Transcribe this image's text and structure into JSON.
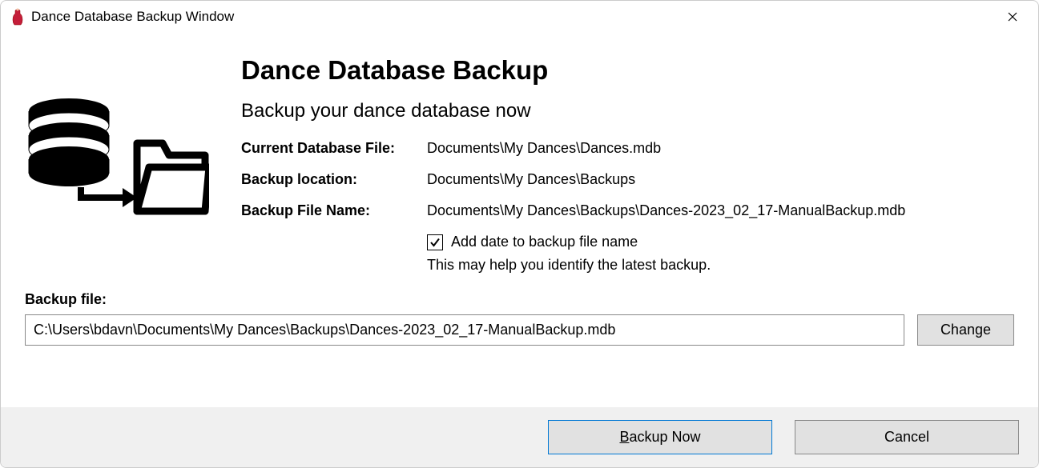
{
  "window": {
    "title": "Dance Database Backup Window"
  },
  "header": {
    "title": "Dance Database Backup",
    "subtitle": "Backup your dance database now"
  },
  "fields": {
    "currentDbLabel": "Current Database File:",
    "currentDbValue": "Documents\\My Dances\\Dances.mdb",
    "backupLocationLabel": "Backup location:",
    "backupLocationValue": "Documents\\My Dances\\Backups",
    "backupFileNameLabel": "Backup File Name:",
    "backupFileNameValue": "Documents\\My Dances\\Backups\\Dances-2023_02_17-ManualBackup.mdb"
  },
  "checkbox": {
    "label": "Add date to backup file name",
    "hint": "This may help you identify the latest backup.",
    "checked": true
  },
  "backupFile": {
    "label": "Backup file:",
    "path": "C:\\Users\\bdavn\\Documents\\My Dances\\Backups\\Dances-2023_02_17-ManualBackup.mdb"
  },
  "buttons": {
    "change": "Change",
    "backupNowPrefix": "B",
    "backupNowRest": "ackup Now",
    "cancel": "Cancel"
  }
}
